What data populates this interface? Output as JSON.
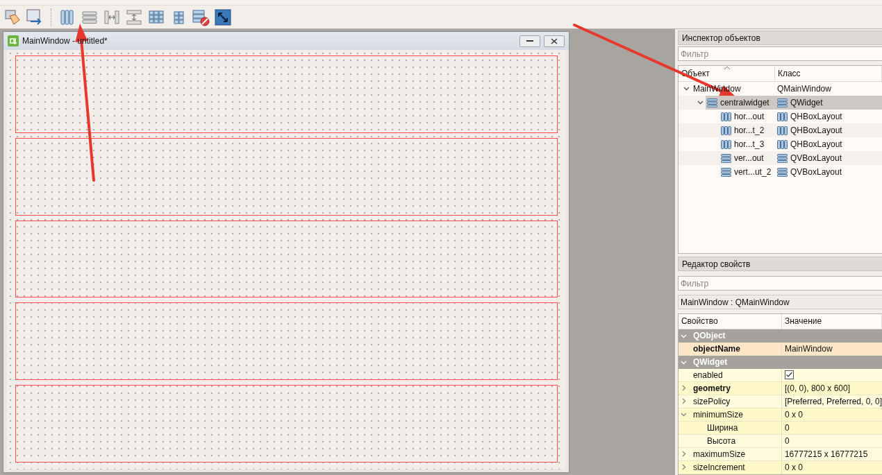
{
  "form": {
    "title": "MainWindow - untitled*",
    "layouts": [
      {
        "kind": "layout"
      },
      {
        "kind": "layout"
      },
      {
        "kind": "layout"
      },
      {
        "kind": "layout"
      },
      {
        "kind": "layout"
      }
    ]
  },
  "inspector": {
    "title": "Инспектор объектов",
    "filter_placeholder": "Фильтр",
    "columns": [
      "Объект",
      "Класс"
    ],
    "tree": [
      {
        "name": "MainWindow",
        "class": "QMainWindow",
        "selected": false,
        "expanded": true,
        "children": [
          {
            "kind": "vbox",
            "name": "centralwidget",
            "class": "QWidget",
            "selected": true,
            "expanded": true,
            "children": [
              {
                "kind": "hbox",
                "name": "hor...out",
                "class": "QHBoxLayout",
                "selected": false
              },
              {
                "kind": "hbox",
                "name": "hor...t_2",
                "class": "QHBoxLayout",
                "selected": false
              },
              {
                "kind": "hbox",
                "name": "hor...t_3",
                "class": "QHBoxLayout",
                "selected": false
              },
              {
                "kind": "vbox",
                "name": "ver...out",
                "class": "QVBoxLayout",
                "selected": false
              },
              {
                "kind": "vbox",
                "name": "vert...ut_2",
                "class": "QVBoxLayout",
                "selected": false
              }
            ]
          }
        ]
      }
    ]
  },
  "properties": {
    "title": "Редактор свойств",
    "filter_placeholder": "Фильтр",
    "object_label": "MainWindow : QMainWindow",
    "columns": [
      "Свойство",
      "Значение"
    ],
    "rows": [
      {
        "kind": "group",
        "name": "QObject",
        "expanded": true
      },
      {
        "kind": "property",
        "name": "objectName",
        "value": "MainWindow",
        "bold": true,
        "selected": true
      },
      {
        "kind": "group",
        "name": "QWidget",
        "expanded": true
      },
      {
        "kind": "check",
        "name": "enabled",
        "checked": true,
        "bold": false,
        "selected": false
      },
      {
        "kind": "property",
        "name": "geometry",
        "value": "[(0, 0), 800 x 600]",
        "bold": true,
        "selected": false,
        "expanded": false
      },
      {
        "kind": "property",
        "name": "sizePolicy",
        "value": "[Preferred, Preferred, 0, 0]",
        "bold": false,
        "selected": false,
        "expanded": false
      },
      {
        "kind": "property",
        "name": "minimumSize",
        "value": "0 x 0",
        "bold": false,
        "selected": false,
        "expanded": true,
        "children": [
          {
            "kind": "property",
            "name": "Ширина",
            "value": "0",
            "bold": false,
            "selected": false
          },
          {
            "kind": "property",
            "name": "Высота",
            "value": "0",
            "bold": false,
            "selected": false
          }
        ]
      },
      {
        "kind": "property",
        "name": "maximumSize",
        "value": "16777215 x 16777215",
        "bold": false,
        "selected": false,
        "expanded": false
      },
      {
        "kind": "property",
        "name": "sizeIncrement",
        "value": "0 x 0",
        "bold": false,
        "selected": false,
        "expanded": false
      }
    ]
  }
}
